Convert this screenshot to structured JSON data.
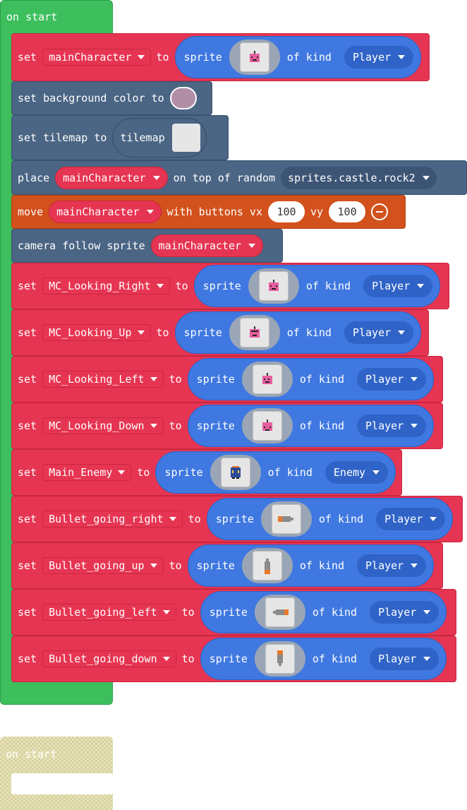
{
  "on_start_label": "on start",
  "disabled_on_start_label": "on start",
  "blocks": {
    "b1": {
      "set": "set",
      "var": "mainCharacter",
      "to": "to",
      "sprite": "sprite",
      "of_kind": "of kind",
      "kind": "Player"
    },
    "b2": {
      "text": "set background color to",
      "color": "#b18ea6"
    },
    "b3": {
      "text": "set tilemap to",
      "tilemap": "tilemap"
    },
    "b4": {
      "place": "place",
      "var": "mainCharacter",
      "on_top": "on top of random",
      "tile": "sprites.castle.rock2"
    },
    "b5": {
      "move": "move",
      "var": "mainCharacter",
      "with_buttons": "with buttons vx",
      "vx": "100",
      "vy_label": "vy",
      "vy": "100"
    },
    "b6": {
      "text": "camera follow sprite",
      "var": "mainCharacter"
    },
    "b7": {
      "set": "set",
      "var": "MC_Looking_Right",
      "to": "to",
      "sprite": "sprite",
      "of_kind": "of kind",
      "kind": "Player"
    },
    "b8": {
      "set": "set",
      "var": "MC_Looking_Up",
      "to": "to",
      "sprite": "sprite",
      "of_kind": "of kind",
      "kind": "Player"
    },
    "b9": {
      "set": "set",
      "var": "MC_Looking_Left",
      "to": "to",
      "sprite": "sprite",
      "of_kind": "of kind",
      "kind": "Player"
    },
    "b10": {
      "set": "set",
      "var": "MC_Looking_Down",
      "to": "to",
      "sprite": "sprite",
      "of_kind": "of kind",
      "kind": "Player"
    },
    "b11": {
      "set": "set",
      "var": "Main_Enemy",
      "to": "to",
      "sprite": "sprite",
      "of_kind": "of kind",
      "kind": "Enemy"
    },
    "b12": {
      "set": "set",
      "var": "Bullet_going_right",
      "to": "to",
      "sprite": "sprite",
      "of_kind": "of kind",
      "kind": "Player"
    },
    "b13": {
      "set": "set",
      "var": "Bullet_going_up",
      "to": "to",
      "sprite": "sprite",
      "of_kind": "of kind",
      "kind": "Player"
    },
    "b14": {
      "set": "set",
      "var": "Bullet_going_left",
      "to": "to",
      "sprite": "sprite",
      "of_kind": "of kind",
      "kind": "Player"
    },
    "b15": {
      "set": "set",
      "var": "Bullet_going_down",
      "to": "to",
      "sprite": "sprite",
      "of_kind": "of kind",
      "kind": "Player"
    }
  },
  "colors": {
    "event": "#3cbf5c",
    "sprites": "#e63552",
    "scene": "#4b6584",
    "controller": "#d2511c",
    "sprite_expr": "#3f78e0"
  },
  "icons": {
    "dropdown": "caret-down-icon",
    "remove": "minus-circle-icon"
  }
}
